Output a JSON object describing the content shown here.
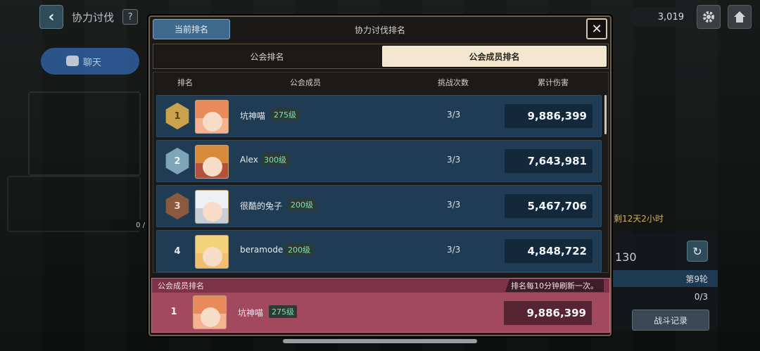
{
  "header": {
    "back_label": "‹",
    "page_title": "协力讨伐",
    "help_label": "?"
  },
  "chat": {
    "label": "聊天"
  },
  "currency": {
    "value3": "3,019"
  },
  "left_counter": "0 /",
  "side": {
    "remain": "剩12天2小时",
    "score": "130",
    "round": "第9轮",
    "count": "0/3",
    "battle_log": "战斗记录"
  },
  "modal": {
    "current_rank_btn": "当前排名",
    "title": "协力讨伐排名",
    "close_label": "✕",
    "tabs": [
      {
        "label": "公会排名",
        "active": false
      },
      {
        "label": "公会成员排名",
        "active": true
      }
    ],
    "columns": {
      "rank": "排名",
      "member": "公会成员",
      "attempts": "挑战次数",
      "damage": "累计伤害"
    },
    "rows": [
      {
        "rank": "1",
        "name": "坑神喵",
        "level": "275级",
        "attempts": "3/3",
        "damage": "9,886,399"
      },
      {
        "rank": "2",
        "name": "Alex",
        "level": "300级",
        "attempts": "3/3",
        "damage": "7,643,981"
      },
      {
        "rank": "3",
        "name": "很酷的兔子",
        "level": "200级",
        "attempts": "3/3",
        "damage": "5,467,706"
      },
      {
        "rank": "4",
        "name": "beramode",
        "level": "200级",
        "attempts": "3/3",
        "damage": "4,848,722"
      }
    ],
    "my_rank": {
      "header": "公会成员排名",
      "refresh_note": "排名每10分钟刷新一次。",
      "rank": "1",
      "name": "坑神喵",
      "level": "275级",
      "damage": "9,886,399"
    }
  }
}
